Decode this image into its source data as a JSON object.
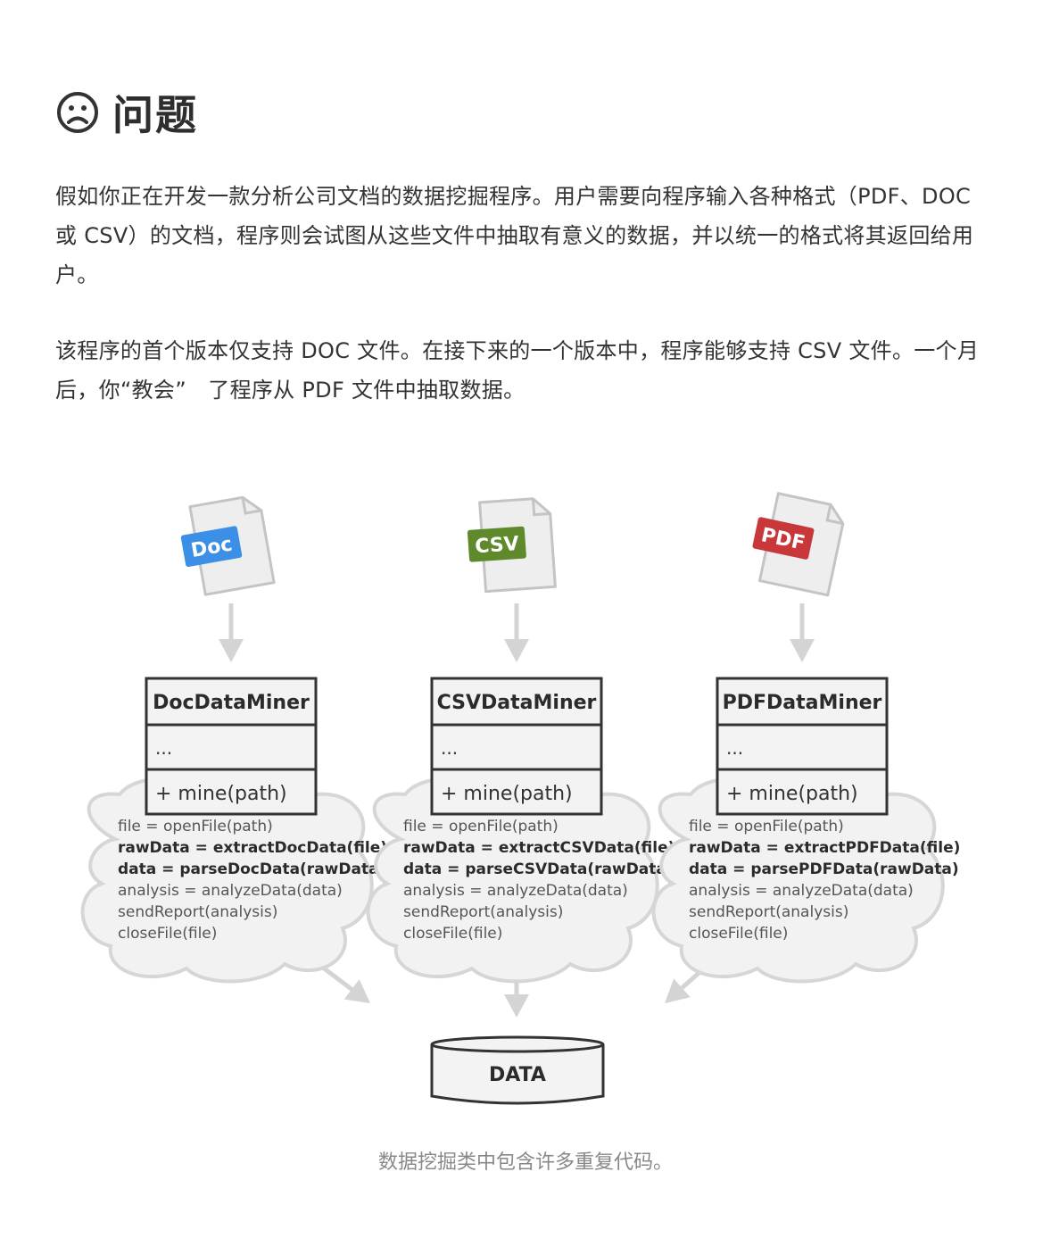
{
  "heading": {
    "icon": "sad-face-icon",
    "title": "问题"
  },
  "paragraphs": [
    "假如你正在开发一款分析公司文档的数据挖掘程序。用户需要向程序输入各种格式（PDF、DOC 或 CSV）的文档，程序则会试图从这些文件中抽取有意义的数据，并以统一的格式将其返回给用户。",
    "该程序的首个版本仅支持 DOC 文件。在接下来的一个版本中，程序能够支持 CSV 文件。一个月后，你“教会”　了程序从 PDF 文件中抽取数据。"
  ],
  "diagram": {
    "miners": [
      {
        "file_badge": "Doc",
        "badge_color": "#3b8fe6",
        "class_name": "DocDataMiner",
        "fields": "...",
        "method": "+ mine(path)",
        "code": [
          {
            "text": "file = openFile(path)",
            "bold": false
          },
          {
            "text": "rawData = extractDocData(file)",
            "bold": true
          },
          {
            "text": "data = parseDocData(rawData)",
            "bold": true
          },
          {
            "text": "analysis = analyzeData(data)",
            "bold": false
          },
          {
            "text": "sendReport(analysis)",
            "bold": false
          },
          {
            "text": "closeFile(file)",
            "bold": false
          }
        ]
      },
      {
        "file_badge": "CSV",
        "badge_color": "#5f8a2c",
        "class_name": "CSVDataMiner",
        "fields": "...",
        "method": "+ mine(path)",
        "code": [
          {
            "text": "file = openFile(path)",
            "bold": false
          },
          {
            "text": "rawData = extractCSVData(file)",
            "bold": true
          },
          {
            "text": "data = parseCSVData(rawData)",
            "bold": true
          },
          {
            "text": "analysis = analyzeData(data)",
            "bold": false
          },
          {
            "text": "sendReport(analysis)",
            "bold": false
          },
          {
            "text": "closeFile(file)",
            "bold": false
          }
        ]
      },
      {
        "file_badge": "PDF",
        "badge_color": "#c8373a",
        "class_name": "PDFDataMiner",
        "fields": "...",
        "method": "+ mine(path)",
        "code": [
          {
            "text": "file = openFile(path)",
            "bold": false
          },
          {
            "text": "rawData = extractPDFData(file)",
            "bold": true
          },
          {
            "text": "data = parsePDFData(rawData)",
            "bold": true
          },
          {
            "text": "analysis = analyzeData(data)",
            "bold": false
          },
          {
            "text": "sendReport(analysis)",
            "bold": false
          },
          {
            "text": "closeFile(file)",
            "bold": false
          }
        ]
      }
    ],
    "storage_label": "DATA"
  },
  "caption": "数据挖掘类中包含许多重复代码。",
  "colors": {
    "line": "#333333",
    "box_fill": "#f3f3f3",
    "cloud_fill": "#f2f2f2",
    "cloud_stroke": "#d6d6d6",
    "arrow": "#d4d4d4"
  }
}
